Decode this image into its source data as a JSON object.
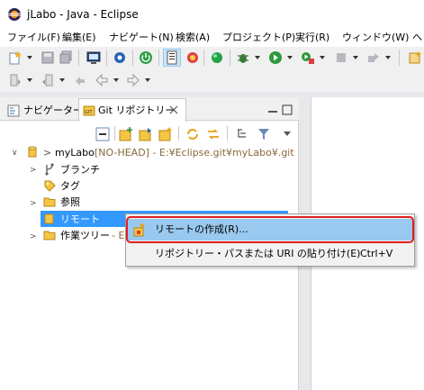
{
  "window": {
    "title": "jLabo - Java - Eclipse"
  },
  "menubar": {
    "items": [
      "ファイル(F)",
      "編集(E)",
      "ナビゲート(N)",
      "検索(A)",
      "プロジェクト(P)",
      "実行(R)",
      "ウィンドウ(W)",
      "ヘ"
    ]
  },
  "tabs": {
    "navigator": "ナビゲーター",
    "git": "Git リポジトリー"
  },
  "tree": {
    "repo_prefix": ">",
    "repo_name": "myLabo",
    "repo_detail": "[NO-HEAD] - E:¥Eclipse.git¥myLabo¥.git",
    "branches": "ブランチ",
    "tags": "タグ",
    "references": "参照",
    "remotes": "リモート",
    "working_tree": "作業ツリー",
    "working_tree_detail": "- E:"
  },
  "context_menu": {
    "create_remote": "リモートの作成(R)...",
    "paste_uri": "リポジトリー・パスまたは URI の貼り付け(E)",
    "paste_shortcut": "Ctrl+V"
  },
  "colors": {
    "highlight": "#99c9ef",
    "callout": "#e02020",
    "selection": "#3399ff"
  }
}
